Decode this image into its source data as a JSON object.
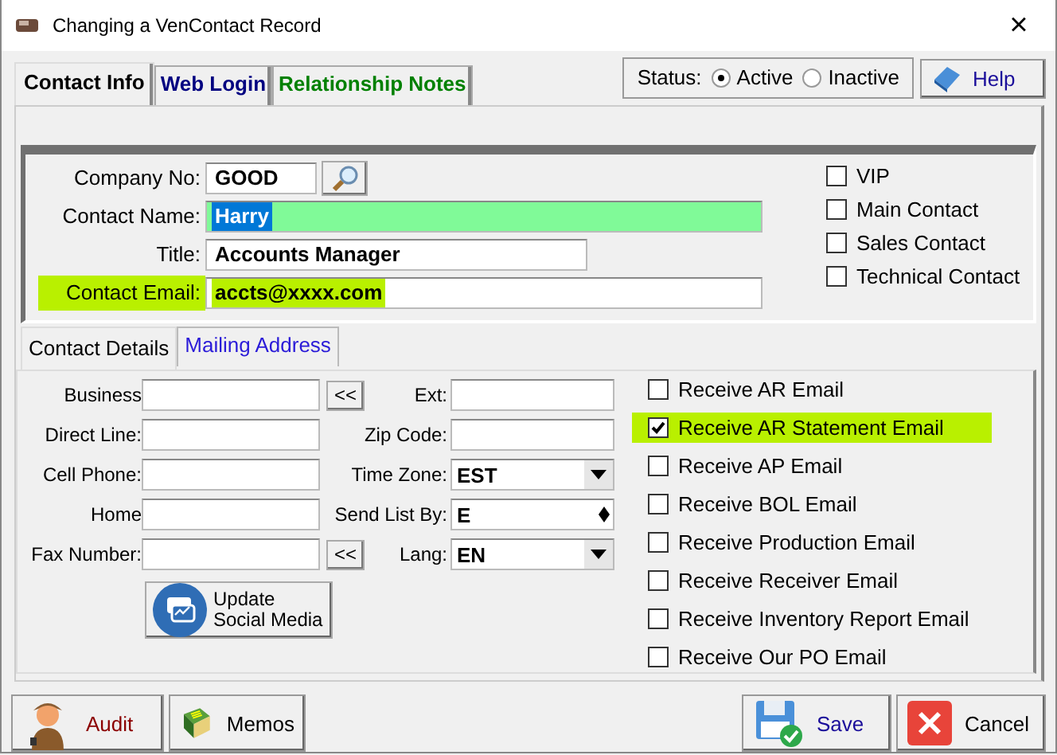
{
  "window": {
    "title": "Changing a VenContact Record",
    "close": "×"
  },
  "tabs": [
    {
      "label": "Contact Info",
      "selected": true,
      "color": "#000000"
    },
    {
      "label": "Web Login",
      "selected": false,
      "color": "#000080"
    },
    {
      "label": "Relationship Notes",
      "selected": false,
      "color": "#008000"
    }
  ],
  "status": {
    "label": "Status:",
    "options": [
      {
        "label": "Active",
        "selected": true
      },
      {
        "label": "Inactive",
        "selected": false
      }
    ]
  },
  "help_button": "Help",
  "main_fields": [
    {
      "label": "Company No:",
      "value": "GOOD",
      "kind": "lookup",
      "highlighted": false
    },
    {
      "label": "Contact Name:",
      "value": "Harry",
      "kind": "name",
      "highlighted": false,
      "color": "#80fa98",
      "text_selected": true
    },
    {
      "label": "Title:",
      "value": "Accounts Manager",
      "kind": "short",
      "highlighted": false
    },
    {
      "label": "Contact Email:",
      "value": "accts@xxxx.com",
      "kind": "long",
      "highlighted": true
    }
  ],
  "flags": [
    {
      "label": "VIP",
      "checked": false
    },
    {
      "label": "Main Contact",
      "checked": false
    },
    {
      "label": "Sales Contact",
      "checked": false
    },
    {
      "label": "Technical Contact",
      "checked": false
    }
  ],
  "sub_tabs": [
    {
      "label": "Contact Details",
      "selected": true
    },
    {
      "label": "Mailing Address",
      "selected": false
    }
  ],
  "phone_fields": [
    {
      "label": "Business",
      "copy_button": "<<"
    },
    {
      "label": "Direct Line:"
    },
    {
      "label": "Cell Phone:"
    },
    {
      "label": "Home"
    },
    {
      "label": "Fax Number:",
      "copy_button": "<<"
    }
  ],
  "detail_fields": [
    {
      "label": "Ext:",
      "kind": "text"
    },
    {
      "label": "Zip Code:",
      "kind": "text"
    },
    {
      "label": "Time Zone:",
      "kind": "combo",
      "value": "EST"
    },
    {
      "label": "Send List By:",
      "kind": "spin",
      "value": "E"
    },
    {
      "label": "Lang:",
      "kind": "combo",
      "value": "EN"
    }
  ],
  "social_button": "Update\nSocial Media",
  "email_options": [
    {
      "label": "Receive AR Email",
      "checked": false,
      "highlighted": false
    },
    {
      "label": "Receive AR Statement Email",
      "checked": true,
      "highlighted": true
    },
    {
      "label": "Receive AP Email",
      "checked": false,
      "highlighted": false
    },
    {
      "label": "Receive BOL Email",
      "checked": false,
      "highlighted": false
    },
    {
      "label": "Receive Production Email",
      "checked": false,
      "highlighted": false
    },
    {
      "label": "Receive Receiver Email",
      "checked": false,
      "highlighted": false
    },
    {
      "label": "Receive Inventory Report Email",
      "checked": false,
      "highlighted": false
    },
    {
      "label": "Receive Our PO Email",
      "checked": false,
      "highlighted": false
    }
  ],
  "footer_buttons": [
    {
      "label": "Audit",
      "kind": "audit"
    },
    {
      "label": "Memos",
      "kind": "memos"
    },
    {
      "label": "Save",
      "kind": "save"
    },
    {
      "label": "Cancel",
      "kind": "cancel"
    }
  ]
}
